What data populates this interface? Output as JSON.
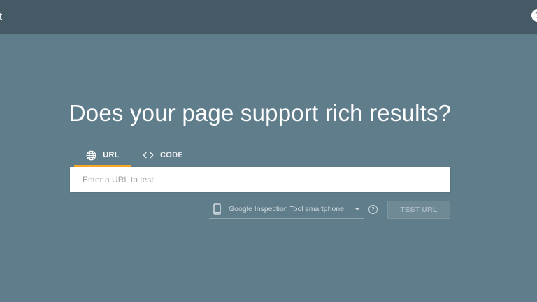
{
  "topbar": {
    "left_text": "t",
    "help_icon": "help-circle-icon"
  },
  "main": {
    "headline": "Does your page support rich results?",
    "tabs": [
      {
        "label": "URL",
        "icon": "globe-icon",
        "active": true
      },
      {
        "label": "CODE",
        "icon": "code-icon",
        "active": false
      }
    ],
    "url_input": {
      "value": "",
      "placeholder": "Enter a URL to test"
    },
    "device_select": {
      "icon": "smartphone-icon",
      "selected": "Google Inspection Tool smartphone"
    },
    "test_button": {
      "label": "TEST URL",
      "enabled": false
    }
  },
  "colors": {
    "background": "#607d8b",
    "topbar": "#455a64",
    "tab_indicator": "#f9a825"
  }
}
